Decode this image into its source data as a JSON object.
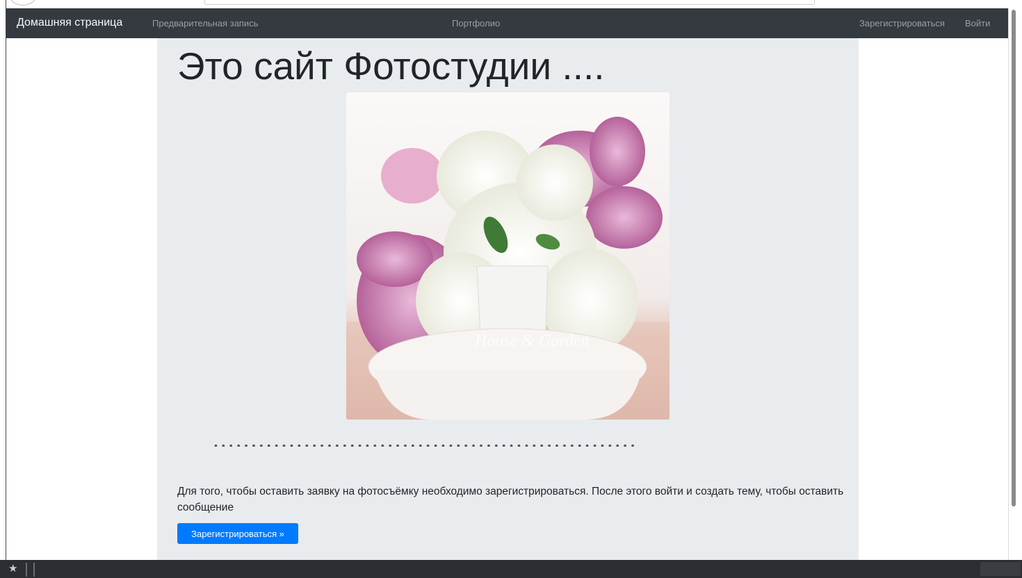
{
  "navbar": {
    "brand": "Домашняя страница",
    "links": {
      "booking": "Предварительная запись",
      "portfolio": "Портфолио",
      "register": "Зарегистрироваться",
      "login": "Войти"
    }
  },
  "hero": {
    "title": "Это сайт Фотостудии ....",
    "separator": "••••••••••••••••••••••••••••••••••••••••••••••••••••••••",
    "info_text": "Для того, чтобы оставить заявку на фотосъёмку необходимо зарегистрироваться. После этого войти и создать тему, чтобы оставить сообщение",
    "register_button": "Зарегистрироваться »"
  },
  "photo": {
    "watermark": "House & Garden",
    "subject": "vase of white and pink lilac flowers"
  },
  "colors": {
    "navbar_bg": "#343a40",
    "jumbotron_bg": "#e9ecef",
    "primary": "#007bff"
  },
  "taskbar": {
    "icons": [
      "star-icon"
    ]
  }
}
